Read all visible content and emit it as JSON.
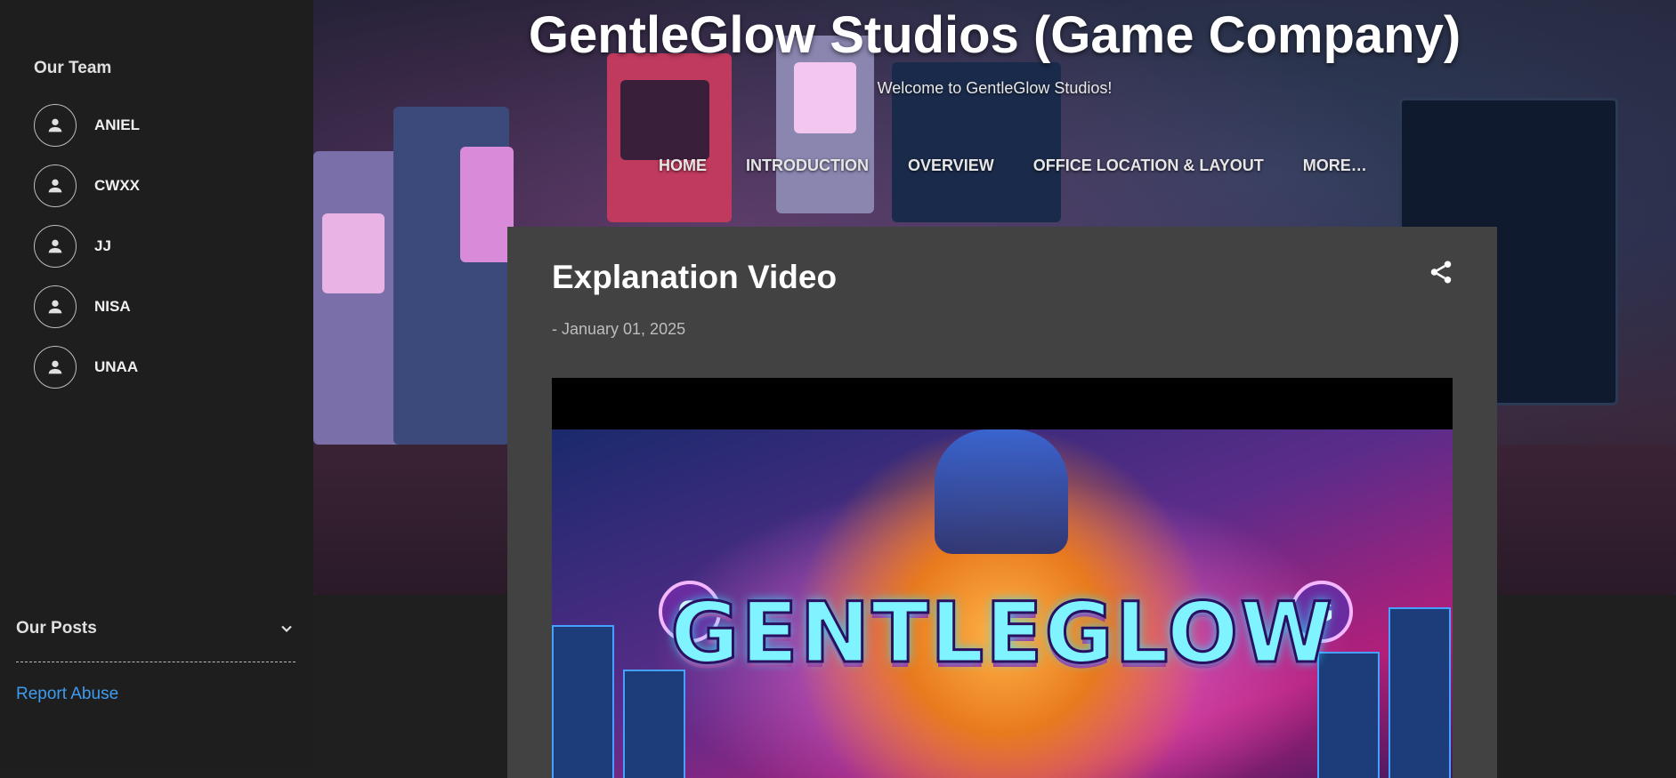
{
  "sidebar": {
    "team_title": "Our Team",
    "members": [
      {
        "name": "ANIEL"
      },
      {
        "name": "CWXX"
      },
      {
        "name": "JJ"
      },
      {
        "name": "NISA"
      },
      {
        "name": "UNAA"
      }
    ],
    "posts_title": "Our Posts",
    "report_abuse": "Report Abuse"
  },
  "header": {
    "site_title": "GentleGlow Studios (Game Company)",
    "subtitle": "Welcome to GentleGlow Studios!",
    "nav": [
      "HOME",
      "INTRODUCTION",
      "OVERVIEW",
      "OFFICE LOCATION & LAYOUT",
      "MORE…"
    ]
  },
  "post": {
    "title": "Explanation Video",
    "date": "- January 01, 2025",
    "video_thumbnail_text": "GENTLEGLOW"
  },
  "colors": {
    "sidebar_bg": "#1e1e1e",
    "card_bg": "#424242",
    "link": "#3d9cf0"
  },
  "icons": [
    "person-icon",
    "chevron-down-icon",
    "share-icon"
  ]
}
